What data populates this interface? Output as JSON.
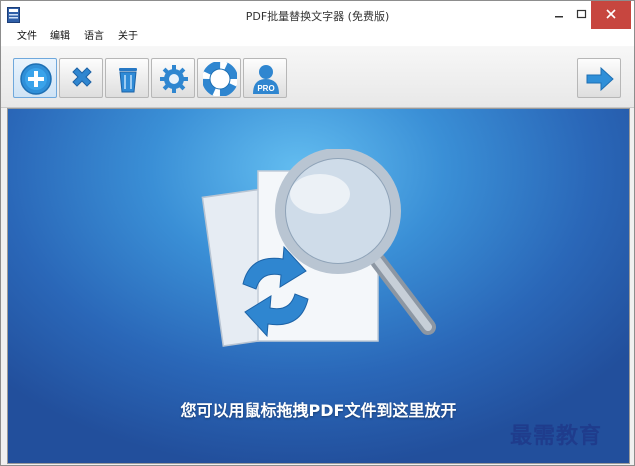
{
  "window": {
    "title": "PDF批量替换文字器 (免费版)",
    "controls": [
      "minimize",
      "maximize",
      "close"
    ]
  },
  "menu": {
    "items": [
      {
        "label": "文件"
      },
      {
        "label": "编辑"
      },
      {
        "label": "语言"
      },
      {
        "label": "关于"
      }
    ]
  },
  "toolbar": {
    "buttons": [
      {
        "icon": "add-icon"
      },
      {
        "icon": "remove-icon"
      },
      {
        "icon": "trash-icon"
      },
      {
        "icon": "settings-icon"
      },
      {
        "icon": "help-icon"
      },
      {
        "icon": "pro-user-icon",
        "badge": "PRO"
      },
      {
        "icon": "next-arrow-icon"
      }
    ]
  },
  "main": {
    "drop_hint": "您可以用鼠标拖拽PDF文件到这里放开"
  },
  "watermark": "最需教育",
  "colors": {
    "accent_blue": "#2a67b8",
    "close_red": "#c7463f",
    "watermark": "#1f3c8c"
  }
}
